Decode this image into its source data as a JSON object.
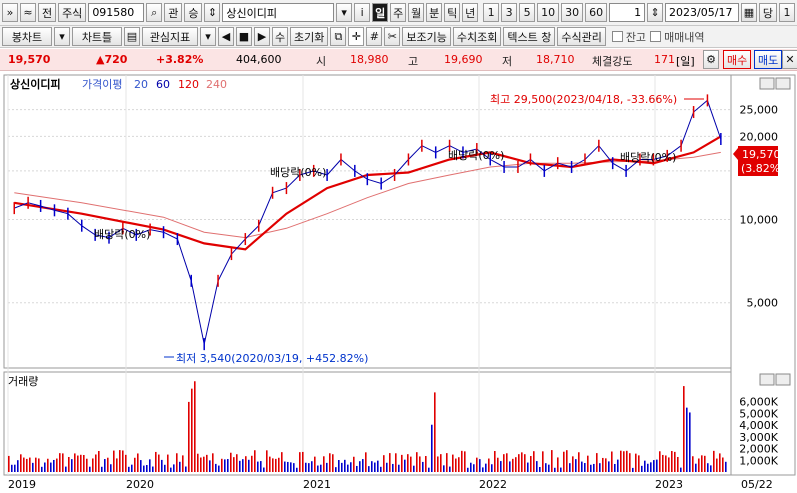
{
  "toolbar1": {
    "expand": "»",
    "updown": "≈",
    "prefix": "전",
    "market": "주식",
    "code": "091580",
    "magnifier": "⌕",
    "gwan": "관",
    "seung": "승",
    "name": "상신이디피",
    "info": "i",
    "periods": [
      "일",
      "주",
      "월",
      "분",
      "틱",
      "년"
    ],
    "period_selected": "일",
    "minutes": [
      "1",
      "3",
      "5",
      "10",
      "30",
      "60"
    ],
    "count": "1",
    "date": "2023/05/17",
    "dang": "당",
    "end": "1"
  },
  "toolbar2": {
    "items": [
      "봉차트",
      "차트틀",
      "관심지표",
      "",
      "■",
      "수",
      "초기화",
      "",
      "",
      "",
      "",
      "보조기능",
      "수치조회",
      "텍스트 창",
      "수식관리"
    ],
    "bongchart": "봉차트",
    "charttl": "차트틀",
    "gwansim": "관심지표",
    "su": "수",
    "reset": "초기화",
    "aux": "보조기능",
    "value": "수치조회",
    "text": "텍스트 창",
    "formula": "수식관리",
    "balance": "잔고",
    "trades": "매매내역"
  },
  "quote": {
    "price": "19,570",
    "change": "▲720",
    "change_pct": "+3.82%",
    "volume": "404,600",
    "open_label": "시",
    "open": "18,980",
    "high_label": "고",
    "high": "19,690",
    "low_label": "저",
    "low": "18,710",
    "strength_label": "체결강도",
    "strength": "171",
    "strength_unit": "[일]",
    "buy": "매수",
    "sell": "매도"
  },
  "price_panel": {
    "stock_name": "상신이디피",
    "legend_label": "가격이평",
    "ma_periods": [
      "20",
      "60",
      "120",
      "240"
    ],
    "ma_colors": [
      "#3355cc",
      "#0000aa",
      "#e00000",
      "#e07070"
    ],
    "last_price": "19,570",
    "last_pct": "(3.82%)",
    "max_label": "최고 29,500(2023/04/18, -33.66%)",
    "min_label": "최저 3,540(2020/03/19, +452.82%)",
    "dividend_labels": [
      "배당락(0%)",
      "배당락(0%)",
      "배당락(0%)",
      "배당락(0%)"
    ]
  },
  "volume_panel": {
    "title": "거래량"
  },
  "chart_data": {
    "type": "line",
    "price_scale": "log",
    "x_labels": [
      "2019",
      "2020",
      "2021",
      "2022",
      "2023",
      "05/22"
    ],
    "y_ticks": [
      "25,000",
      "20,000",
      "15,000",
      "10,000",
      "5,000"
    ],
    "y_values": [
      25000,
      20000,
      15000,
      10000,
      5000
    ],
    "ylim": [
      3000,
      32000
    ],
    "close": [
      {
        "t": "2019-01",
        "v": 11000
      },
      {
        "t": "2019-02",
        "v": 11500
      },
      {
        "t": "2019-03",
        "v": 11200
      },
      {
        "t": "2019-04",
        "v": 10800
      },
      {
        "t": "2019-05",
        "v": 10500
      },
      {
        "t": "2019-06",
        "v": 9500
      },
      {
        "t": "2019-07",
        "v": 8800
      },
      {
        "t": "2019-08",
        "v": 8600
      },
      {
        "t": "2019-09",
        "v": 9300
      },
      {
        "t": "2019-10",
        "v": 8800
      },
      {
        "t": "2019-11",
        "v": 9200
      },
      {
        "t": "2019-12",
        "v": 9000
      },
      {
        "t": "2020-01",
        "v": 8500
      },
      {
        "t": "2020-02",
        "v": 6000
      },
      {
        "t": "2020-03",
        "v": 3540
      },
      {
        "t": "2020-04",
        "v": 6000
      },
      {
        "t": "2020-05",
        "v": 7500
      },
      {
        "t": "2020-06",
        "v": 8500
      },
      {
        "t": "2020-07",
        "v": 9500
      },
      {
        "t": "2020-08",
        "v": 12500
      },
      {
        "t": "2020-09",
        "v": 13000
      },
      {
        "t": "2020-10",
        "v": 14500
      },
      {
        "t": "2020-11",
        "v": 15000
      },
      {
        "t": "2020-12",
        "v": 14500
      },
      {
        "t": "2021-01",
        "v": 16500
      },
      {
        "t": "2021-02",
        "v": 15000
      },
      {
        "t": "2021-03",
        "v": 14000
      },
      {
        "t": "2021-04",
        "v": 13500
      },
      {
        "t": "2021-05",
        "v": 14500
      },
      {
        "t": "2021-06",
        "v": 16500
      },
      {
        "t": "2021-07",
        "v": 18500
      },
      {
        "t": "2021-08",
        "v": 17500
      },
      {
        "t": "2021-09",
        "v": 18500
      },
      {
        "t": "2021-10",
        "v": 17500
      },
      {
        "t": "2021-11",
        "v": 18000
      },
      {
        "t": "2021-12",
        "v": 16500
      },
      {
        "t": "2022-01",
        "v": 15500
      },
      {
        "t": "2022-02",
        "v": 15500
      },
      {
        "t": "2022-03",
        "v": 16500
      },
      {
        "t": "2022-04",
        "v": 15000
      },
      {
        "t": "2022-05",
        "v": 16000
      },
      {
        "t": "2022-06",
        "v": 15500
      },
      {
        "t": "2022-07",
        "v": 16500
      },
      {
        "t": "2022-08",
        "v": 18500
      },
      {
        "t": "2022-09",
        "v": 16000
      },
      {
        "t": "2022-10",
        "v": 15000
      },
      {
        "t": "2022-11",
        "v": 16500
      },
      {
        "t": "2022-12",
        "v": 16500
      },
      {
        "t": "2023-01",
        "v": 17000
      },
      {
        "t": "2023-02",
        "v": 18500
      },
      {
        "t": "2023-03",
        "v": 24500
      },
      {
        "t": "2023-04",
        "v": 27000
      },
      {
        "t": "2023-05",
        "v": 19570
      }
    ],
    "ma240": [
      {
        "t": "2019-01",
        "v": 12500
      },
      {
        "t": "2019-06",
        "v": 11500
      },
      {
        "t": "2019-12",
        "v": 10200
      },
      {
        "t": "2020-03",
        "v": 9000
      },
      {
        "t": "2020-06",
        "v": 8600
      },
      {
        "t": "2020-09",
        "v": 9300
      },
      {
        "t": "2020-12",
        "v": 10500
      },
      {
        "t": "2021-03",
        "v": 12000
      },
      {
        "t": "2021-06",
        "v": 13500
      },
      {
        "t": "2021-09",
        "v": 14500
      },
      {
        "t": "2021-12",
        "v": 15500
      },
      {
        "t": "2022-03",
        "v": 16000
      },
      {
        "t": "2022-06",
        "v": 16000
      },
      {
        "t": "2022-09",
        "v": 16200
      },
      {
        "t": "2022-12",
        "v": 16300
      },
      {
        "t": "2023-03",
        "v": 16800
      },
      {
        "t": "2023-05",
        "v": 17500
      }
    ],
    "ma120": [
      {
        "t": "2019-01",
        "v": 11500
      },
      {
        "t": "2019-06",
        "v": 10500
      },
      {
        "t": "2019-12",
        "v": 9200
      },
      {
        "t": "2020-03",
        "v": 8200
      },
      {
        "t": "2020-06",
        "v": 7800
      },
      {
        "t": "2020-09",
        "v": 10500
      },
      {
        "t": "2020-12",
        "v": 13000
      },
      {
        "t": "2021-03",
        "v": 14500
      },
      {
        "t": "2021-06",
        "v": 14800
      },
      {
        "t": "2021-09",
        "v": 16500
      },
      {
        "t": "2021-12",
        "v": 17500
      },
      {
        "t": "2022-03",
        "v": 16000
      },
      {
        "t": "2022-06",
        "v": 15500
      },
      {
        "t": "2022-09",
        "v": 16500
      },
      {
        "t": "2022-12",
        "v": 16000
      },
      {
        "t": "2023-03",
        "v": 17500
      },
      {
        "t": "2023-05",
        "v": 20000
      }
    ],
    "volume_ylabels": [
      "6,000K",
      "5,000K",
      "4,000K",
      "3,000K",
      "2,000K",
      "1,000K"
    ],
    "volume_values": [
      6000,
      5000,
      4000,
      3000,
      2000,
      1000
    ],
    "volume_max": 7000
  }
}
